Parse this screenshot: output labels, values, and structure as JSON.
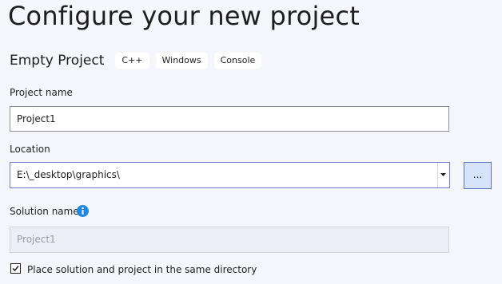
{
  "page": {
    "title": "Configure your new project"
  },
  "template": {
    "name": "Empty Project",
    "tags": [
      "C++",
      "Windows",
      "Console"
    ]
  },
  "project_name": {
    "label": "Project name",
    "value": "Project1"
  },
  "location": {
    "label": "Location",
    "value": "E:\\_desktop\\graphics\\",
    "browse_label": "..."
  },
  "solution_name": {
    "label": "Solution name",
    "placeholder": "Project1",
    "info_icon": "info-icon"
  },
  "same_directory": {
    "label": "Place solution and project in the same directory",
    "checked": true
  },
  "colors": {
    "background": "#f5f6fb",
    "accent": "#1e88e5",
    "focus_border": "#6c7bd6",
    "button_bg": "#d6e3f8"
  }
}
